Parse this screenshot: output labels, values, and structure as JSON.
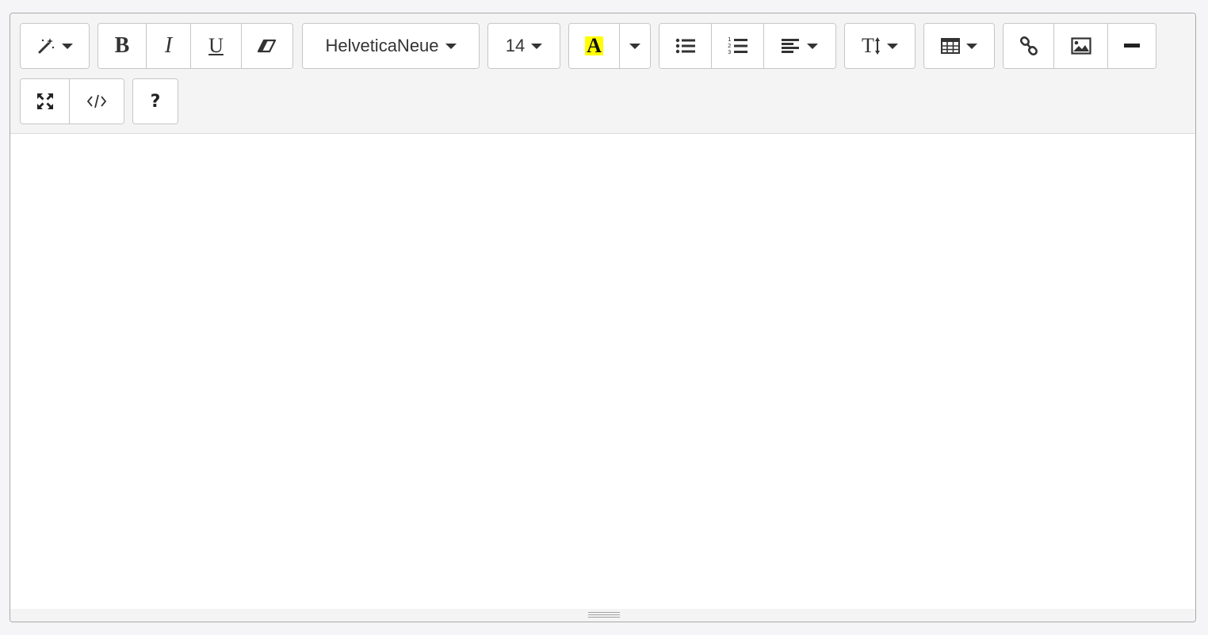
{
  "toolbar": {
    "style_group": {
      "icon": "magic-wand-icon"
    },
    "font_group": {
      "bold_label": "B",
      "italic_label": "I",
      "underline_label": "U",
      "clear_icon": "eraser-icon"
    },
    "font_name": "HelveticaNeue",
    "font_size": "14",
    "color": {
      "label": "A",
      "highlight_color": "#ffff00"
    },
    "paragraph": {
      "unordered_icon": "bullet-list-icon",
      "ordered_icon": "numbered-list-icon",
      "align_icon": "align-left-icon"
    },
    "height_icon": "text-height-icon",
    "height_label": "T",
    "table_icon": "table-icon",
    "insert": {
      "link_icon": "link-icon",
      "picture_icon": "image-icon",
      "hr_icon": "horizontal-rule-icon"
    },
    "view": {
      "fullscreen_icon": "fullscreen-icon",
      "codeview_icon": "code-icon"
    },
    "help_label": "?"
  },
  "editor": {
    "content": ""
  }
}
